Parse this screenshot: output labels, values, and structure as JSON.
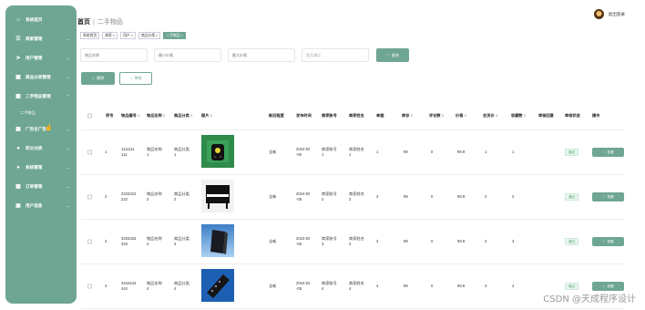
{
  "sidebar": {
    "items": [
      {
        "label": "系统首页",
        "icon": "home-icon",
        "chevron": false
      },
      {
        "label": "商家管理",
        "icon": "grid-icon",
        "chevron": true
      },
      {
        "label": "用户管理",
        "icon": "send-icon",
        "chevron": true
      },
      {
        "label": "商品分类管理",
        "icon": "grid-icon",
        "chevron": true
      },
      {
        "label": "二手物品管理",
        "icon": "grid-icon",
        "chevron": true
      },
      {
        "label": "广告位广告",
        "icon": "grid-icon",
        "chevron": true
      },
      {
        "label": "积分兑换",
        "icon": "pin-icon",
        "chevron": true
      },
      {
        "label": "系统管理",
        "icon": "bulb-icon",
        "chevron": true
      },
      {
        "label": "订单管理",
        "icon": "grid-icon",
        "chevron": true
      },
      {
        "label": "用户信息",
        "icon": "window-icon",
        "chevron": true
      }
    ],
    "sub_item": "二手物品"
  },
  "header": {
    "breadcrumb_home": "首页",
    "breadcrumb_current": "二手物品",
    "user_label": "退出登录"
  },
  "tags": [
    "系统首页",
    "商家 ×",
    "用户 ×",
    "商品分类 ×",
    "二手物品 ×"
  ],
  "search": {
    "name_placeholder": "物品名称",
    "min_price_placeholder": "最小价格",
    "max_price_placeholder": "最大价格",
    "status_placeholder": "是否通过",
    "search_label": "查询"
  },
  "actions": {
    "delete_label": "删除",
    "review_label": "审核"
  },
  "table": {
    "headers": [
      "序号",
      "物品编号",
      "物品名称",
      "商品分类",
      "图片",
      "新旧程度",
      "发布时间",
      "商家账号",
      "商家姓名",
      "单据",
      "库存",
      "评论数",
      "价格",
      "会员价",
      "收藏数",
      "审核回复",
      "审核状态",
      "操作"
    ],
    "rows": [
      {
        "idx": "1",
        "code_a": "1111111",
        "code_b": "111",
        "name_a": "物品名称",
        "name_b": "1",
        "cat_a": "商品分类",
        "cat_b": "1",
        "pic": "remote",
        "cond": "全新",
        "date_a": "2024-02",
        "date_b": "-05",
        "acct_a": "商家账号",
        "acct_b": "1",
        "mname_a": "商家姓名",
        "mname_b": "1",
        "doc": "1",
        "stock": "99",
        "comments": "0",
        "price": "99.9",
        "vip": "1",
        "fav": "1",
        "status": "通过",
        "view": "查看"
      },
      {
        "idx": "2",
        "code_a": "2222222",
        "code_b": "222",
        "name_a": "物品名称",
        "name_b": "2",
        "cat_a": "商品分类",
        "cat_b": "2",
        "pic": "piano",
        "cond": "全新",
        "date_a": "2024-02",
        "date_b": "-05",
        "acct_a": "商家账号",
        "acct_b": "2",
        "mname_a": "商家姓名",
        "mname_b": "2",
        "doc": "2",
        "stock": "99",
        "comments": "0",
        "price": "99.9",
        "vip": "2",
        "fav": "2",
        "status": "通过",
        "view": "查看"
      },
      {
        "idx": "3",
        "code_a": "3333333",
        "code_b": "333",
        "name_a": "物品名称",
        "name_b": "3",
        "cat_a": "商品分类",
        "cat_b": "3",
        "pic": "speaker",
        "cond": "全新",
        "date_a": "2024-02",
        "date_b": "-05",
        "acct_a": "商家账号",
        "acct_b": "3",
        "mname_a": "商家姓名",
        "mname_b": "3",
        "doc": "3",
        "stock": "99",
        "comments": "0",
        "price": "99.9",
        "vip": "3",
        "fav": "3",
        "status": "通过",
        "view": "查看"
      },
      {
        "idx": "4",
        "code_a": "4444444",
        "code_b": "444",
        "name_a": "物品名称",
        "name_b": "4",
        "cat_a": "商品分类",
        "cat_b": "4",
        "pic": "tvremote",
        "cond": "全新",
        "date_a": "2024-02",
        "date_b": "-05",
        "acct_a": "商家账号",
        "acct_b": "4",
        "mname_a": "商家姓名",
        "mname_b": "4",
        "doc": "4",
        "stock": "99",
        "comments": "0",
        "price": "99.9",
        "vip": "4",
        "fav": "4",
        "status": "通过",
        "view": "查看"
      }
    ]
  },
  "watermark": "CSDN @天成程序设计",
  "colors": {
    "accent": "#6fa693",
    "status_green": "#52a36c"
  }
}
